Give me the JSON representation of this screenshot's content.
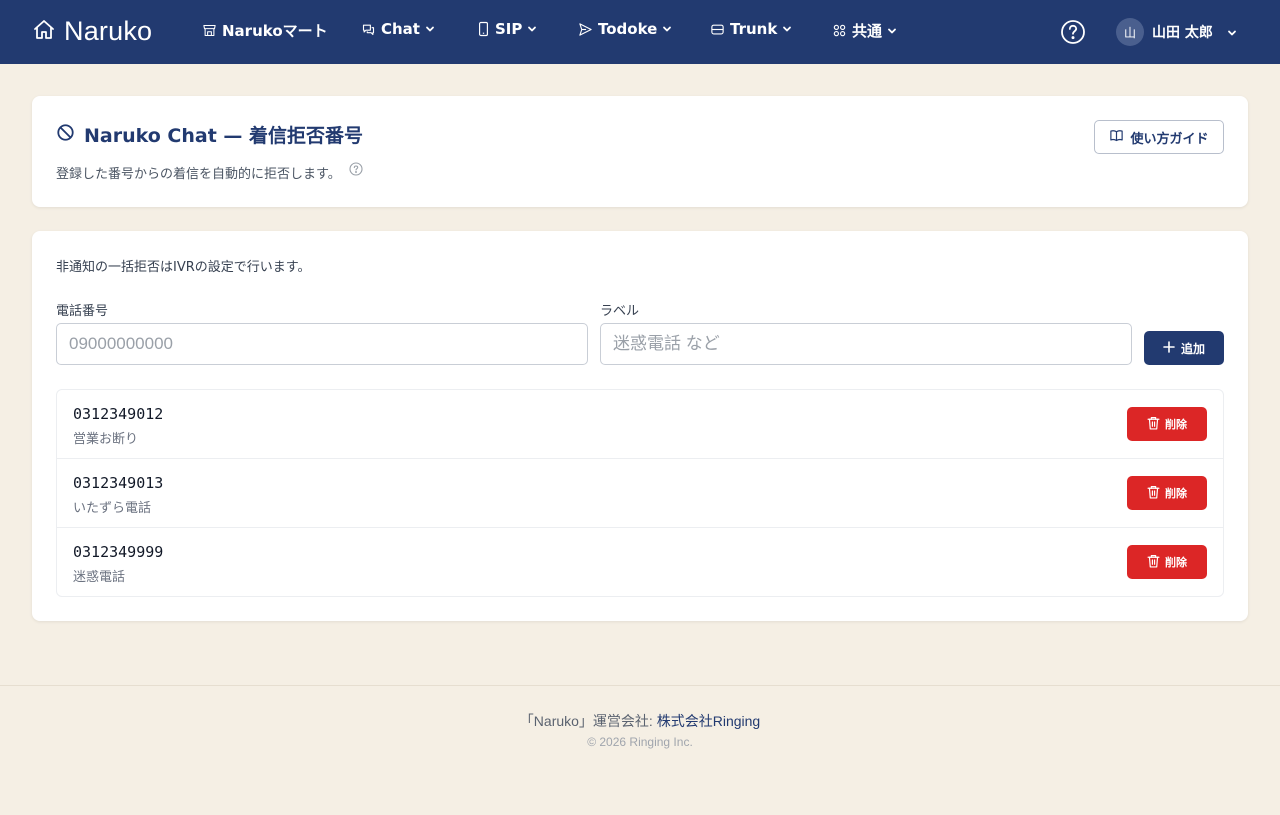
{
  "nav": {
    "brand": "Naruko",
    "items": [
      {
        "label": "Narukoマート",
        "icon": "store-icon",
        "dropdown": false
      },
      {
        "label": "Chat",
        "icon": "chat-icon",
        "dropdown": true
      },
      {
        "label": "SIP",
        "icon": "phone-icon",
        "dropdown": true
      },
      {
        "label": "Todoke",
        "icon": "send-icon",
        "dropdown": true
      },
      {
        "label": "Trunk",
        "icon": "server-icon",
        "dropdown": true
      },
      {
        "label": "共通",
        "icon": "grid-icon",
        "dropdown": true
      }
    ],
    "help_icon": "help-circle-icon",
    "user": {
      "avatar": "山",
      "name": "山田 太郎"
    }
  },
  "header_card": {
    "title": "Naruko Chat — 着信拒否番号",
    "title_icon": "block-icon",
    "subtitle": "登録した番号からの着信を自動的に拒否します。",
    "guide_button": "使い方ガイド"
  },
  "form": {
    "notice": "非通知の一括拒否はIVRの設定で行います。",
    "phone_label": "電話番号",
    "phone_placeholder": "09000000000",
    "phone_value": "",
    "label_label": "ラベル",
    "label_placeholder": "迷惑電話 など",
    "label_value": "",
    "add_button": "追加"
  },
  "blocked_numbers": [
    {
      "number": "0312349012",
      "label": "営業お断り",
      "delete": "削除"
    },
    {
      "number": "0312349013",
      "label": "いたずら電話",
      "delete": "削除"
    },
    {
      "number": "0312349999",
      "label": "迷惑電話",
      "delete": "削除"
    }
  ],
  "footer": {
    "operator_text": "「Naruko」運営会社: ",
    "operator_link": "株式会社Ringing",
    "copyright": "© 2026 Ringing Inc."
  },
  "colors": {
    "nav_bg": "#223a70",
    "page_bg": "#f5efe4",
    "primary": "#223a70",
    "danger": "#dc2626"
  }
}
